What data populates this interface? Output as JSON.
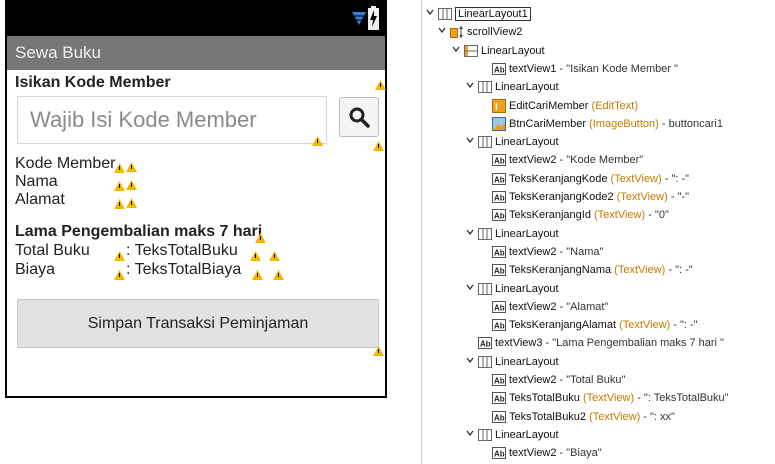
{
  "app": {
    "title": "Sewa Buku"
  },
  "form": {
    "heading": "Isikan Kode Member",
    "search_placeholder": "Wajib Isi Kode Member",
    "kode_label": "Kode Member",
    "nama_label": "Nama",
    "alamat_label": "Alamat",
    "lama_heading": "Lama Pengembalian maks 7 hari",
    "total_label": "Total Buku",
    "total_value": ": TeksTotalBuku",
    "biaya_label": "Biaya",
    "biaya_value": ": TeksTotalBiaya",
    "save_button": "Simpan Transaksi Peminjaman"
  },
  "icons": {
    "wifi": "wifi-icon",
    "battery": "battery-charging-icon",
    "search": "search-icon",
    "warning": "warning-icon"
  },
  "colors": {
    "actionbar": "#777777",
    "wifi": "#3a7bd5",
    "warning": "#f2b800",
    "type_text": "#c47a00"
  },
  "tree": {
    "nodes": [
      {
        "name": "LinearLayout1",
        "type": "",
        "value": ""
      },
      {
        "name": "scrollView2",
        "type": "",
        "value": ""
      },
      {
        "name": "LinearLayout",
        "type": "",
        "value": ""
      },
      {
        "name": "textView1",
        "type": "",
        "value": " - \"Isikan Kode Member \""
      },
      {
        "name": "LinearLayout",
        "type": "",
        "value": ""
      },
      {
        "name": "EditCariMember",
        "type": " (EditText)",
        "value": ""
      },
      {
        "name": "BtnCariMember",
        "type": " (ImageButton)",
        "value": " - buttoncari1"
      },
      {
        "name": "LinearLayout",
        "type": "",
        "value": ""
      },
      {
        "name": "textView2",
        "type": "",
        "value": " - \"Kode Member\""
      },
      {
        "name": "TeksKeranjangKode",
        "type": " (TextView)",
        "value": " - \": -\""
      },
      {
        "name": "TeksKeranjangKode2",
        "type": " (TextView)",
        "value": " - \"-\""
      },
      {
        "name": "TeksKeranjangId",
        "type": " (TextView)",
        "value": " - \"0\""
      },
      {
        "name": "LinearLayout",
        "type": "",
        "value": ""
      },
      {
        "name": "textView2",
        "type": "",
        "value": " - \"Nama\""
      },
      {
        "name": "TeksKeranjangNama",
        "type": " (TextView)",
        "value": " - \": -\""
      },
      {
        "name": "LinearLayout",
        "type": "",
        "value": ""
      },
      {
        "name": "textView2",
        "type": "",
        "value": " - \"Alamat\""
      },
      {
        "name": "TeksKeranjangAlamat",
        "type": " (TextView)",
        "value": " - \": -\""
      },
      {
        "name": "textView3",
        "type": "",
        "value": " - \"Lama Pengembalian maks 7 hari \""
      },
      {
        "name": "LinearLayout",
        "type": "",
        "value": ""
      },
      {
        "name": "textView2",
        "type": "",
        "value": " - \"Total Buku\""
      },
      {
        "name": "TeksTotalBuku",
        "type": " (TextView)",
        "value": " - \": TeksTotalBuku\""
      },
      {
        "name": "TeksTotalBuku2",
        "type": " (TextView)",
        "value": " - \": xx\""
      },
      {
        "name": "LinearLayout",
        "type": "",
        "value": ""
      },
      {
        "name": "textView2",
        "type": "",
        "value": " - \"Biaya\""
      }
    ]
  }
}
